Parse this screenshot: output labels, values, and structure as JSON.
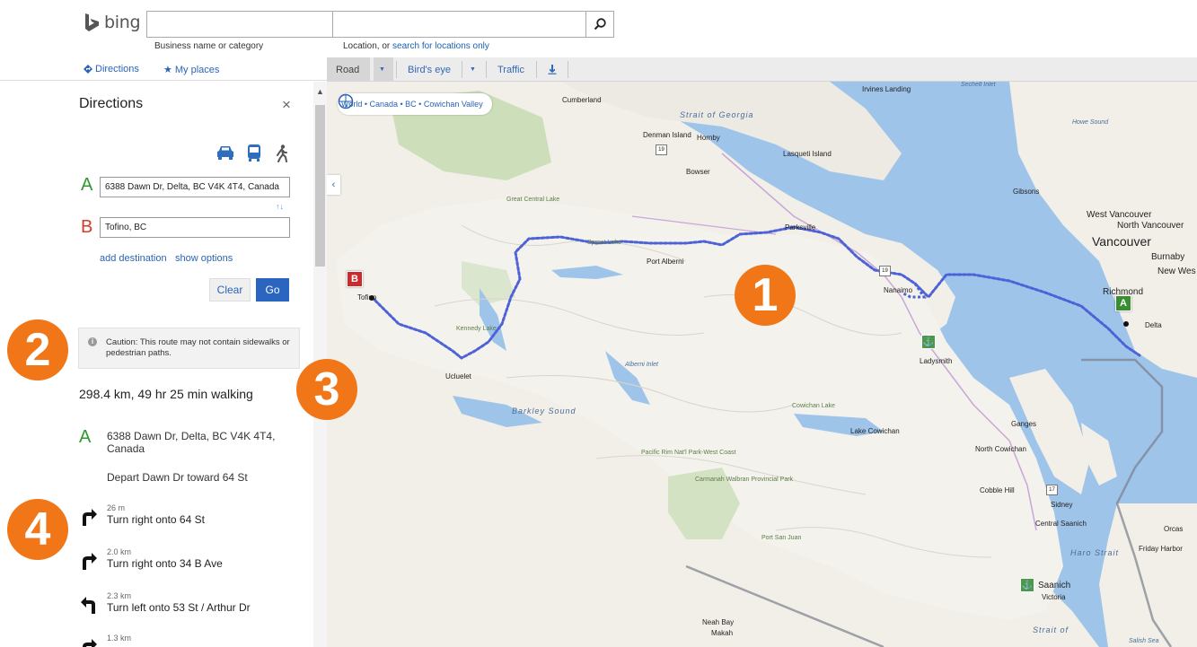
{
  "header": {
    "logo_text": "bing",
    "business_field": {
      "value": "",
      "placeholder": ""
    },
    "business_caption": "Business name or category",
    "location_field": {
      "value": "",
      "placeholder": ""
    },
    "location_caption_prefix": "Location, or ",
    "location_caption_link": "search for locations only"
  },
  "nav": {
    "directions": "Directions",
    "my_places": "My places"
  },
  "map_toolbar": {
    "road": "Road",
    "birds_eye": "Bird's eye",
    "traffic": "Traffic"
  },
  "directions_panel": {
    "title": "Directions",
    "close": "×",
    "letter_a": "A",
    "letter_b": "B",
    "start_value": "6388 Dawn Dr, Delta, BC V4K 4T4, Canada",
    "end_value": "Tofino, BC",
    "swap": "↑↓",
    "add_destination": "add destination",
    "show_options": "show options",
    "clear": "Clear",
    "go": "Go",
    "caution": "Caution: This route may not contain sidewalks or pedestrian paths.",
    "summary": "298.4 km, 49 hr 25 min walking",
    "start_letter": "A",
    "start_address": "6388 Dawn Dr, Delta, BC V4K 4T4, Canada",
    "depart": "Depart Dawn Dr toward 64 St",
    "steps": [
      {
        "dist": "26 m",
        "text": "Turn right onto 64 St",
        "turn": "right"
      },
      {
        "dist": "2.0 km",
        "text": "Turn right onto 34 B Ave",
        "turn": "right"
      },
      {
        "dist": "2.3 km",
        "text": "Turn left onto 53 St / Arthur Dr",
        "turn": "left"
      },
      {
        "dist": "1.3 km",
        "text": "",
        "turn": "right"
      }
    ]
  },
  "map": {
    "breadcrumb": "World • Canada • BC • Cowichan Valley",
    "marker_a": "A",
    "marker_b": "B",
    "places": {
      "vancouver": "Vancouver",
      "west_vancouver": "West Vancouver",
      "north_vancouver": "North Vancouver",
      "burnaby": "Burnaby",
      "new_west": "New Wes",
      "richmond": "Richmond",
      "delta": "Delta",
      "nanaimo": "Nanaimo",
      "port_alberni": "Port Alberni",
      "parksville": "Parksville",
      "ladysmith": "Ladysmith",
      "lake_cowichan": "Lake Cowichan",
      "north_cowichan": "North Cowichan",
      "cobble_hill": "Cobble Hill",
      "sidney": "Sidney",
      "central_saanich": "Central Saanich",
      "saanich": "Saanich",
      "victoria": "Victoria",
      "ucluelet": "Ucluelet",
      "tofino": "Tofino",
      "gibsons": "Gibsons",
      "lasqueti": "Lasqueti Island",
      "bowser": "Bowser",
      "cumberland": "Cumberland",
      "denman": "Denman Island",
      "hornby": "Hornby",
      "ganges": "Ganges",
      "friday_harbor": "Friday Harbor",
      "orcas": "Orcas",
      "neah_bay": "Neah Bay",
      "makah": "Makah",
      "powell": "Irvines Landing",
      "great_central_lake": "Great Central Lake",
      "kennedy_lake": "Kennedy Lake",
      "sproat_lake": "Sproat Lake",
      "cowichan_lake": "Cowichan Lake",
      "port_san_juan": "Port San Juan",
      "pacific_rim": "Pacific Rim Nat'l Park-West Coast",
      "carmanah": "Carmanah Walbran Provincial Park"
    },
    "water": {
      "strait_georgia": "Strait of Georgia",
      "barkley": "Barkley Sound",
      "alberni_inlet": "Alberni Inlet",
      "haro": "Haro Strait",
      "strait_bottom": "Strait of",
      "salish": "Salish Sea",
      "howe": "Howe Sound",
      "sechelt": "Sechelt Inlet"
    },
    "highways": [
      "19",
      "19",
      "17"
    ]
  },
  "callouts": [
    "1",
    "2",
    "3",
    "4"
  ],
  "colors": {
    "accent": "#2a65c0",
    "callout": "#f07617",
    "route": "#4e62d8",
    "water": "#9fc4ea",
    "land": "#f2efe8"
  }
}
